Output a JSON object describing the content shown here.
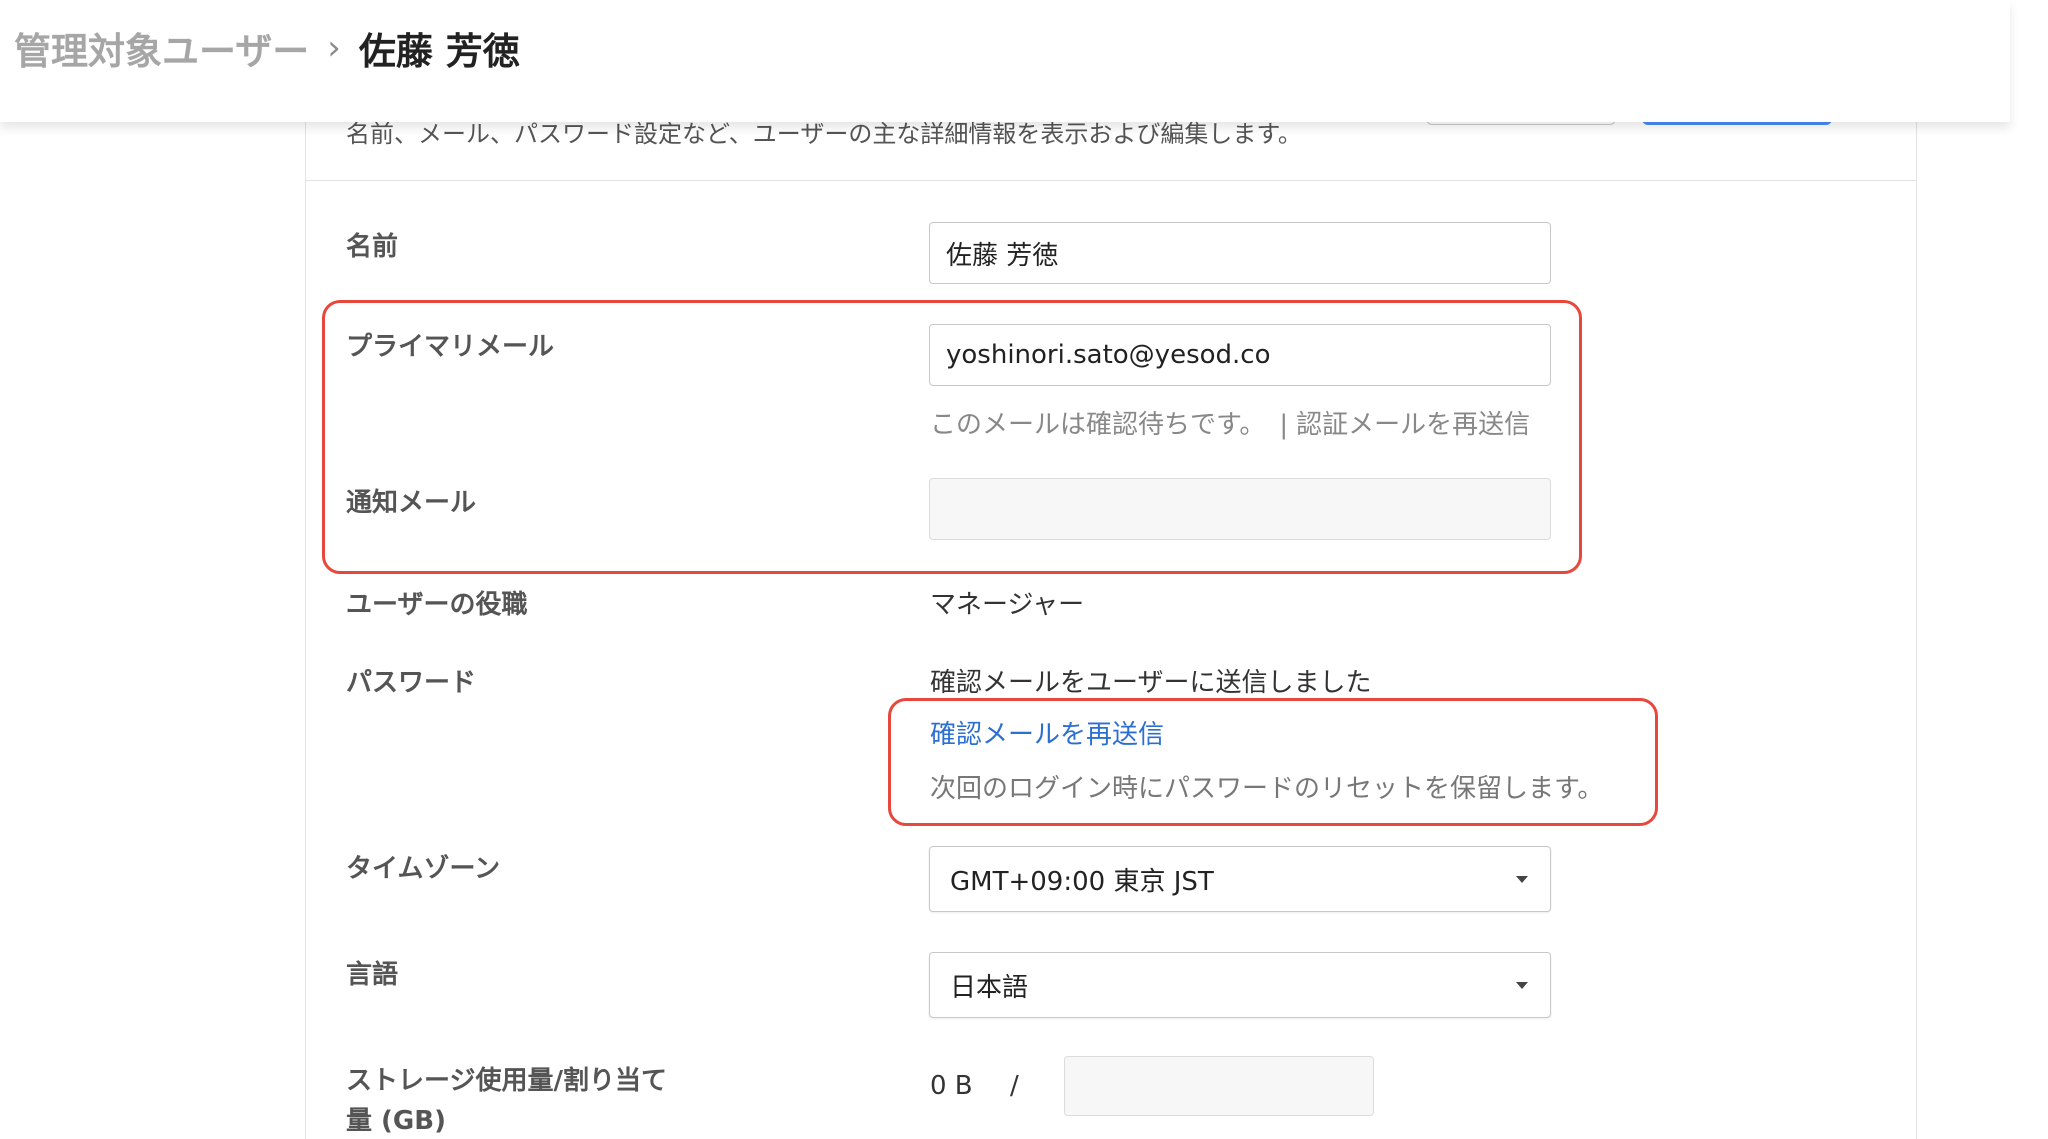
{
  "breadcrumb": {
    "parent": "管理対象ユーザー",
    "separator": "›",
    "current": "佐藤 芳徳"
  },
  "panel": {
    "description": "名前、メール、パスワード設定など、ユーザーの主な詳細情報を表示および編集します。"
  },
  "fields": {
    "name": {
      "label": "名前",
      "value": "佐藤 芳徳"
    },
    "primary_email": {
      "label": "プライマリメール",
      "value": "yoshinori.sato@yesod.co",
      "status": "このメールは確認待ちです。",
      "separator": "|",
      "resend": "認証メールを再送信"
    },
    "notification_email": {
      "label": "通知メール",
      "value": ""
    },
    "role": {
      "label": "ユーザーの役職",
      "value": "マネージャー"
    },
    "password": {
      "label": "パスワード",
      "status": "確認メールをユーザーに送信しました",
      "resend_link": "確認メールを再送信",
      "note": "次回のログイン時にパスワードのリセットを保留します。"
    },
    "timezone": {
      "label": "タイムゾーン",
      "value": "GMT+09:00 東京 JST"
    },
    "language": {
      "label": "言語",
      "value": "日本語"
    },
    "storage": {
      "label_line1": "ストレージ使用量/割り当て",
      "label_line2": "量 (GB)",
      "used": "0 B",
      "separator": "/",
      "quota": ""
    }
  },
  "colors": {
    "highlight": "#e8483c",
    "link": "#2d6fd1",
    "primary_button": "#4a8cf7"
  }
}
